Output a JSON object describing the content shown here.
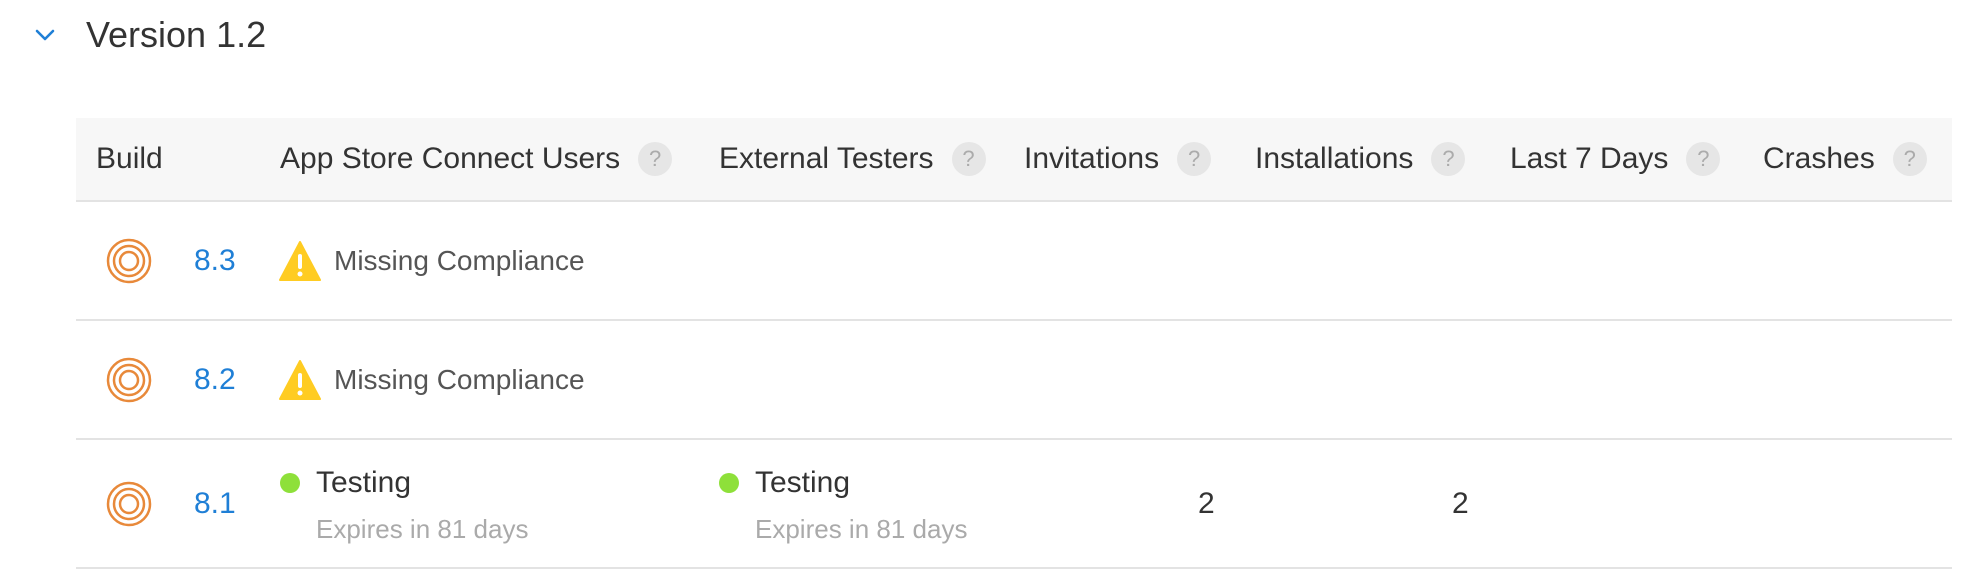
{
  "version": {
    "title": "Version 1.2"
  },
  "columns": [
    {
      "label": "Build",
      "has_help": false
    },
    {
      "label": "App Store Connect Users",
      "has_help": true
    },
    {
      "label": "External Testers",
      "has_help": true
    },
    {
      "label": "Invitations",
      "has_help": true
    },
    {
      "label": "Installations",
      "has_help": true
    },
    {
      "label": "Last 7 Days",
      "has_help": true
    },
    {
      "label": "Crashes",
      "has_help": true
    }
  ],
  "help_glyph": "?",
  "builds": [
    {
      "number": "8.3",
      "status": "Missing Compliance"
    },
    {
      "number": "8.2",
      "status": "Missing Compliance"
    },
    {
      "number": "8.1",
      "app_store_connect_users": {
        "status": "Testing",
        "note": "Expires in 81 days"
      },
      "external_testers": {
        "status": "Testing",
        "note": "Expires in 81 days"
      },
      "invitations": "2",
      "installations": "2"
    }
  ],
  "colors": {
    "link": "#1f7fd6",
    "warning": "#ffcc22",
    "testing_dot": "#8ee03a",
    "build_icon": "#e8893a"
  },
  "icons": {
    "collapse": "chevron-down-icon",
    "build": "build-rings-icon",
    "warning": "warning-icon",
    "help": "help-icon"
  }
}
